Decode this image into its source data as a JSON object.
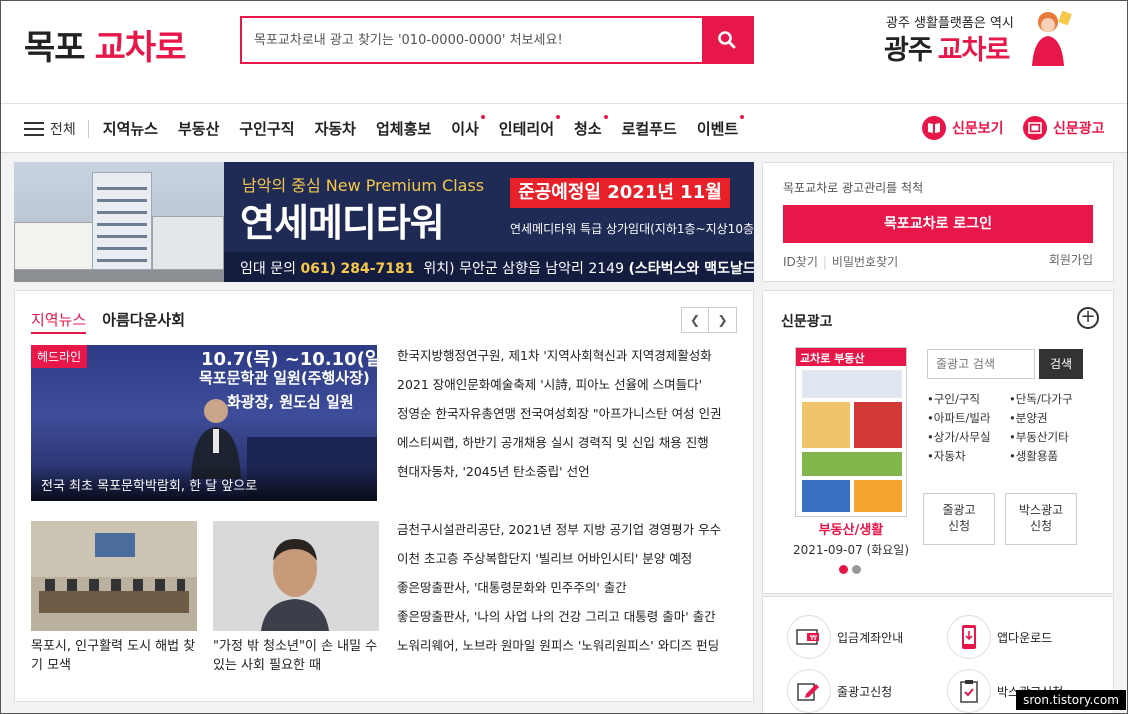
{
  "header": {
    "logo_part1": "목포",
    "logo_part2": "교차로",
    "search_placeholder": "목포교차로내 광고 찾기는 '010-0000-0000' 처보세요!",
    "promo_line1": "광주 생활플랫폼은 역시",
    "promo_part1": "광주",
    "promo_part2": "교차로"
  },
  "nav": {
    "all_label": "전체",
    "items": [
      {
        "label": "지역뉴스",
        "dot": false
      },
      {
        "label": "부동산",
        "dot": false
      },
      {
        "label": "구인구직",
        "dot": false
      },
      {
        "label": "자동차",
        "dot": false
      },
      {
        "label": "업체홍보",
        "dot": false
      },
      {
        "label": "이사",
        "dot": true
      },
      {
        "label": "인테리어",
        "dot": true
      },
      {
        "label": "청소",
        "dot": true
      },
      {
        "label": "로컬푸드",
        "dot": false
      },
      {
        "label": "이벤트",
        "dot": true
      }
    ],
    "newspaper_view": "신문보기",
    "newspaper_ad": "신문광고"
  },
  "banner": {
    "subtitle": "남악의 중심 New Premium Class",
    "title": "연세메디타워",
    "tag": "준공예정일 2021년 11월",
    "detail": "연세메디타워 특급 상가임대(지하1층~지상10층)",
    "contact_prefix": "임대 문의",
    "contact_area": "061)",
    "contact_number": "284-7181",
    "location_prefix": "위치) 무안군 삼향읍 남악리 2149",
    "location_highlight": "(스타벅스와 맥도날드 사이)"
  },
  "login": {
    "title": "목포교차로 광고관리를 척척",
    "button": "목포교차로 로그인",
    "find_id": "ID찾기",
    "find_pw": "비밀번호찾기",
    "join": "회원가입"
  },
  "news": {
    "tab_active": "지역뉴스",
    "tab_other": "아름다운사회",
    "headline_badge": "헤드라인",
    "headline_sign1": "10.7(목) ~10.10(일)",
    "headline_sign2": "목포문학관 일원(주행사장)",
    "headline_sign3": "화광장, 원도심 일원",
    "headline_caption": "전국 최초 목포문학박람회, 한 달 앞으로",
    "thumb1_caption": "목포시, 인구활력 도시 해법 찾기 모색",
    "thumb2_caption": "\"가정 밖 청소년\"이 손 내밀 수 있는 사회 필요한 때",
    "list1": [
      "한국지방행정연구원, 제1차 '지역사회혁신과 지역경제활성화",
      "2021 장애인문화예술축제 '시詩, 피아노 선율에 스며들다'",
      "정영순 한국자유총연맹 전국여성회장 \"아프가니스탄 여성 인권",
      "에스티씨랩, 하반기 공개채용 실시 경력직 및 신입 채용 진행",
      "현대자동차, '2045년 탄소중립' 선언"
    ],
    "list2": [
      "금천구시설관리공단, 2021년 정부 지방 공기업 경영평가 우수",
      "이천 초고층 주상복합단지 '빌리브 어바인시티' 분양 예정",
      "좋은땅출판사, '대통령문화와 민주주의' 출간",
      "좋은땅출판사, '나의 사업 나의 건강 그리고 대통령 출마' 출간",
      "노워리웨어, 노브라 원마일 원피스 '노워리원피스' 와디즈 펀딩"
    ]
  },
  "newspaper_ads": {
    "title": "신문광고",
    "paper_label": "교차로 부동산",
    "category": "부동산/생활",
    "date": "2021-09-07 (화요일)",
    "search_placeholder": "줄광고 검색",
    "search_button": "검색",
    "categories": [
      "•구인/구직",
      "•단독/다가구",
      "•아파트/빌라",
      "•분양권",
      "•상가/사무실",
      "•부동산기타",
      "•자동차",
      "•생활용품"
    ],
    "line_ad_btn": "줄광고\n신청",
    "box_ad_btn": "박스광고\n신청",
    "accent": "#e8174a"
  },
  "quick": {
    "deposit": "입금계좌안내",
    "app": "앱다운로드",
    "line_ad": "줄광고신청",
    "box_ad": "박스광고신청"
  },
  "watermark": "sron.tistory.com"
}
